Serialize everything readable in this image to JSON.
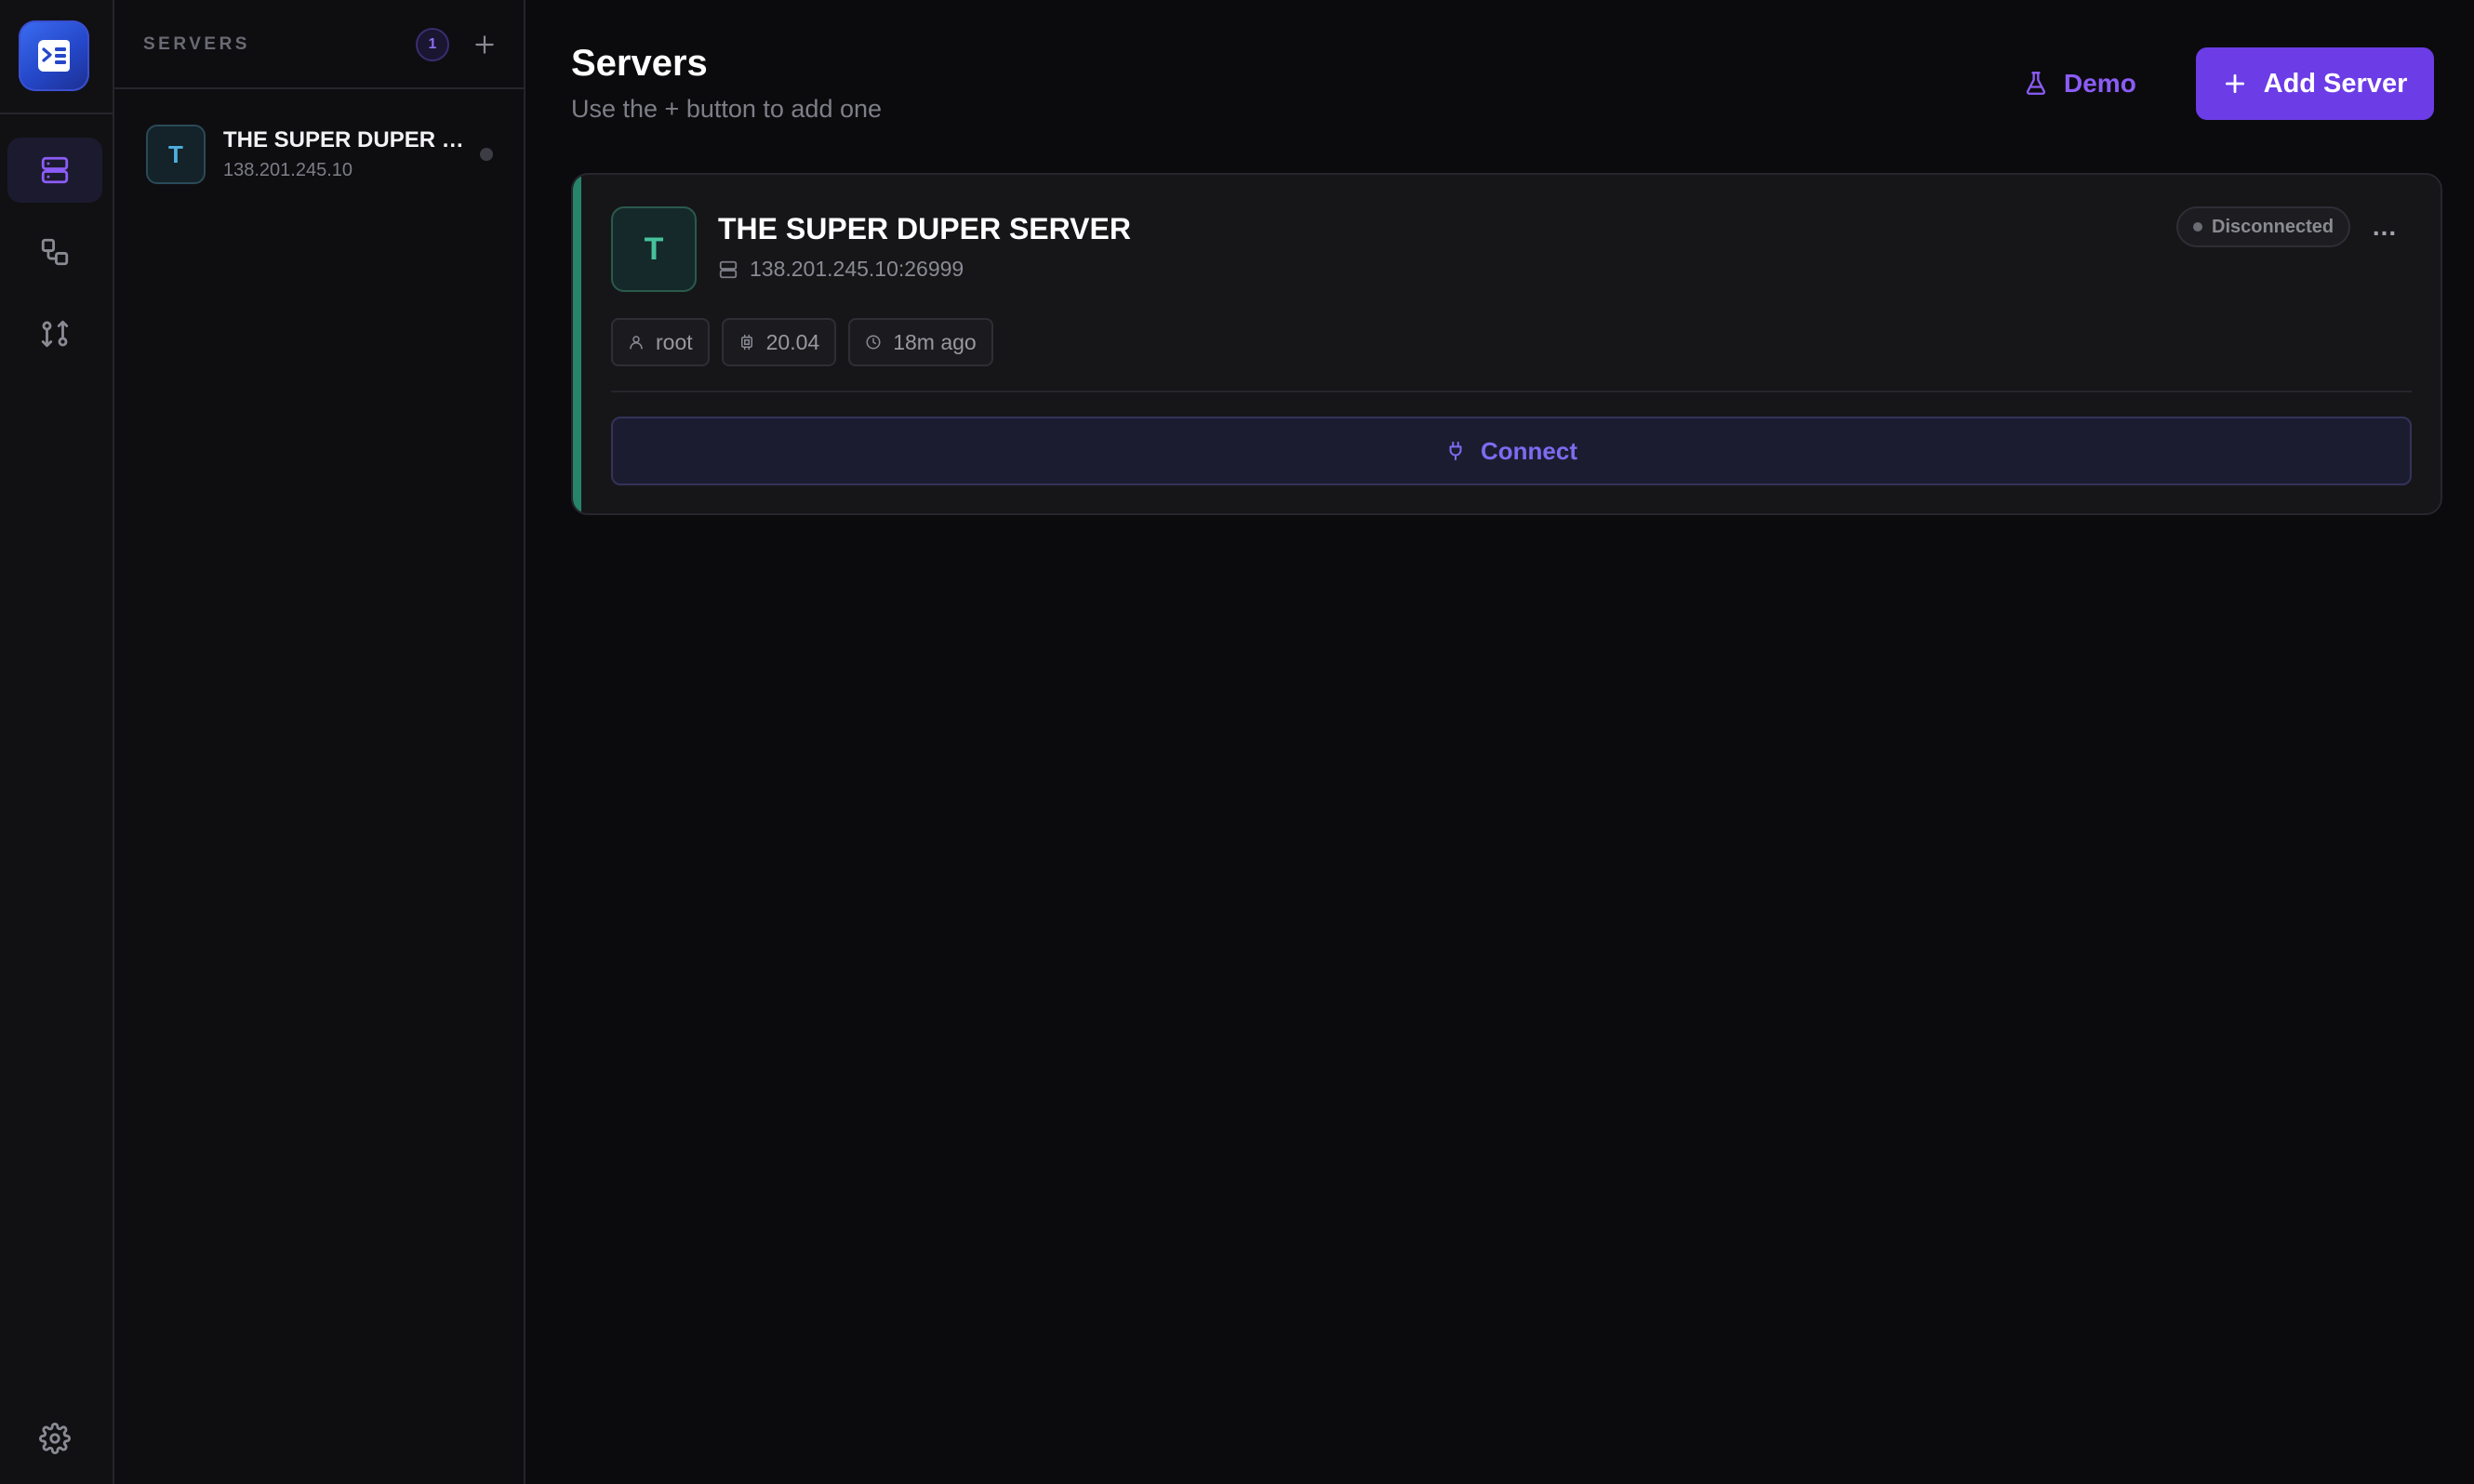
{
  "sidebar": {
    "title": "SERVERS",
    "count": "1",
    "nav_icons": [
      "servers-icon",
      "connections-icon",
      "transfer-icon"
    ],
    "settings_icon": "gear-icon"
  },
  "server_list": [
    {
      "initial": "T",
      "name": "THE SUPER DUPER SERVER",
      "ip": "138.201.245.10",
      "status": "offline"
    }
  ],
  "header": {
    "title": "Servers",
    "subtitle": "Use the + button to add one",
    "demo_label": "Demo",
    "add_label": "Add Server"
  },
  "card": {
    "initial": "T",
    "name": "THE SUPER DUPER SERVER",
    "address": "138.201.245.10:26999",
    "status": "Disconnected",
    "more": "...",
    "chips": {
      "user": "root",
      "version": "20.04",
      "last_seen": "18m ago"
    },
    "connect_label": "Connect"
  },
  "colors": {
    "accent": "#6c3ce6",
    "link": "#8b5cf6",
    "card_accent": "#27846a",
    "background": "#0b0b0d"
  }
}
